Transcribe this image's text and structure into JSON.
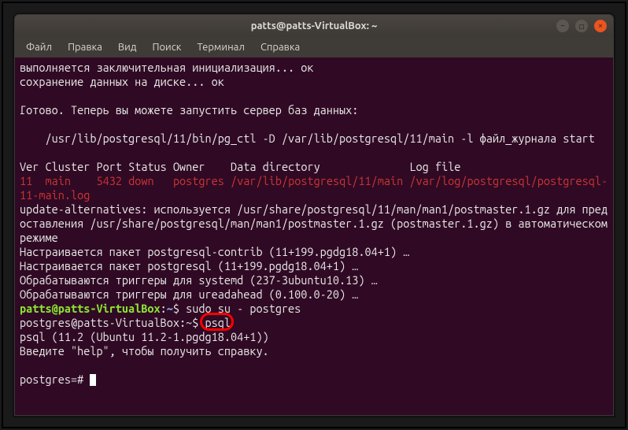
{
  "window": {
    "title": "patts@patts-VirtualBox: ~"
  },
  "menu": {
    "items": [
      "Файл",
      "Правка",
      "Вид",
      "Поиск",
      "Терминал",
      "Справка"
    ]
  },
  "term": {
    "l1": "выполняется заключительная инициализация... ок",
    "l2": "сохранение данных на диске... ок",
    "blank1": " ",
    "l3": "Готово. Теперь вы можете запустить сервер баз данных:",
    "blank2": " ",
    "l4": "    /usr/lib/postgresql/11/bin/pg_ctl -D /var/lib/postgresql/11/main -l файл_журнала start",
    "blank3": " ",
    "h_ver": "Ver",
    "h_cluster": "Cluster",
    "h_port": "Port",
    "h_status": "Status",
    "h_owner": "Owner",
    "h_datadir": "Data directory",
    "h_logfile": "Log file",
    "row_ver": "11",
    "row_cluster": "main",
    "row_port": "5432",
    "row_status": "down",
    "row_owner": "postgres",
    "row_datadir": "/var/lib/postgresql/11/main",
    "row_logfile": "/var/log/postgresql/postgresql-11-main.log",
    "l5": "update-alternatives: используется /usr/share/postgresql/11/man/man1/postmaster.1.gz для предоставления /usr/share/postgresql/man/man1/postmaster.1.gz (postmaster.1.gz) в автоматическом режиме",
    "l6": "Настраивается пакет postgresql-contrib (11+199.pgdg18.04+1) …",
    "l7": "Настраивается пакет postgresql (11+199.pgdg18.04+1) …",
    "l8": "Обрабатываются триггеры для systemd (237-3ubuntu10.13) …",
    "l9": "Обрабатываются триггеры для ureadahead (0.100.0-20) …",
    "prompt1_user": "patts@patts-VirtualBox",
    "prompt1_colon": ":",
    "prompt1_path": "~",
    "prompt1_end": "$ ",
    "cmd1": "sudo su - postgres",
    "prompt2": "postgres@patts-VirtualBox:~$ ",
    "cmd2": "psql",
    "l10": "psql (11.2 (Ubuntu 11.2-1.pgdg18.04+1))",
    "l11": "Введите \"help\", чтобы получить справку.",
    "blank4": " ",
    "prompt3": "postgres=# "
  },
  "annotation": {
    "highlighted_command": "psql"
  }
}
